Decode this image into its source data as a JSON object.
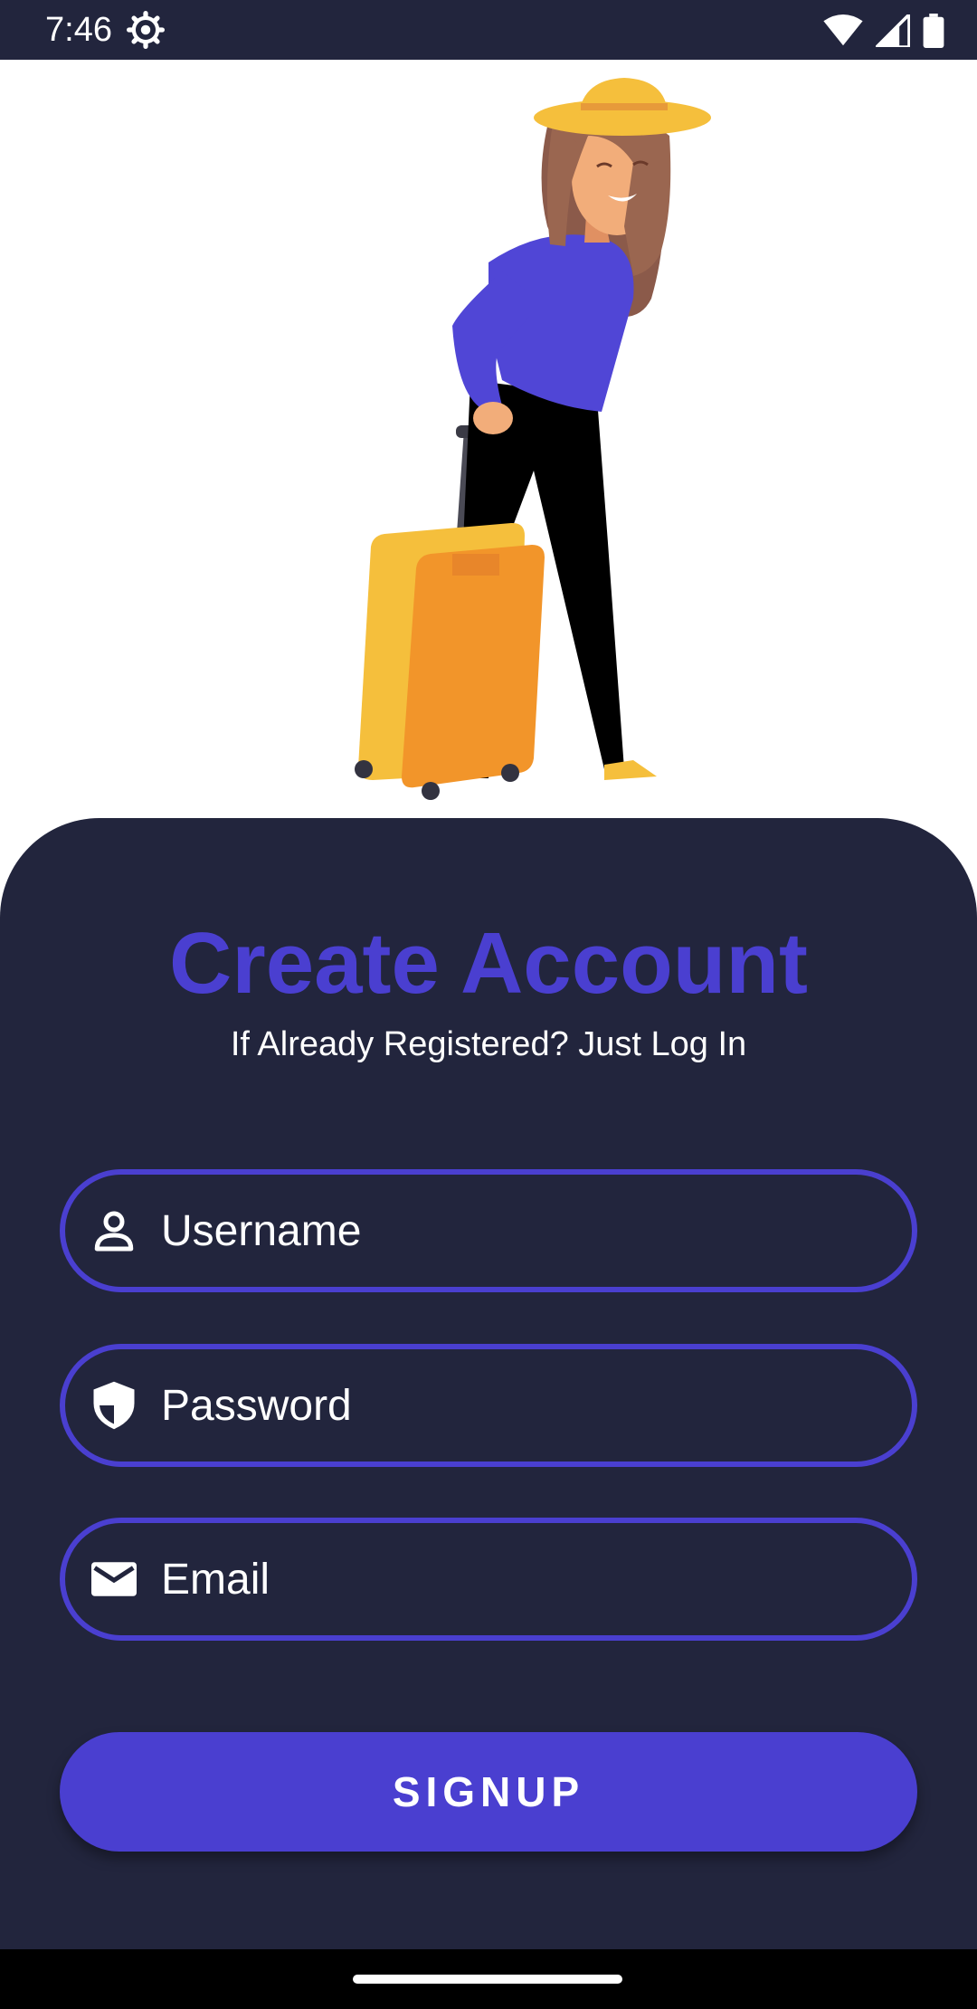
{
  "status_bar": {
    "time": "7:46",
    "icons": [
      "settings-gear-icon",
      "wifi-icon",
      "signal-icon",
      "battery-icon"
    ]
  },
  "hero": {
    "illustration": "traveler-with-suitcase"
  },
  "auth": {
    "title": "Create Account",
    "subtitle": "If Already Registered? Just Log In",
    "fields": {
      "username": {
        "placeholder": "Username",
        "value": "",
        "icon": "person-icon"
      },
      "password": {
        "placeholder": "Password",
        "value": "",
        "icon": "shield-icon"
      },
      "email": {
        "placeholder": "Email",
        "value": "",
        "icon": "mail-icon"
      }
    },
    "signup_label": "SIGNUP"
  },
  "colors": {
    "background_dark": "#22253d",
    "accent": "#4a3fd0",
    "text_light": "#ffffff",
    "suitcase": "#f2952a",
    "hat": "#f5bf3c"
  }
}
